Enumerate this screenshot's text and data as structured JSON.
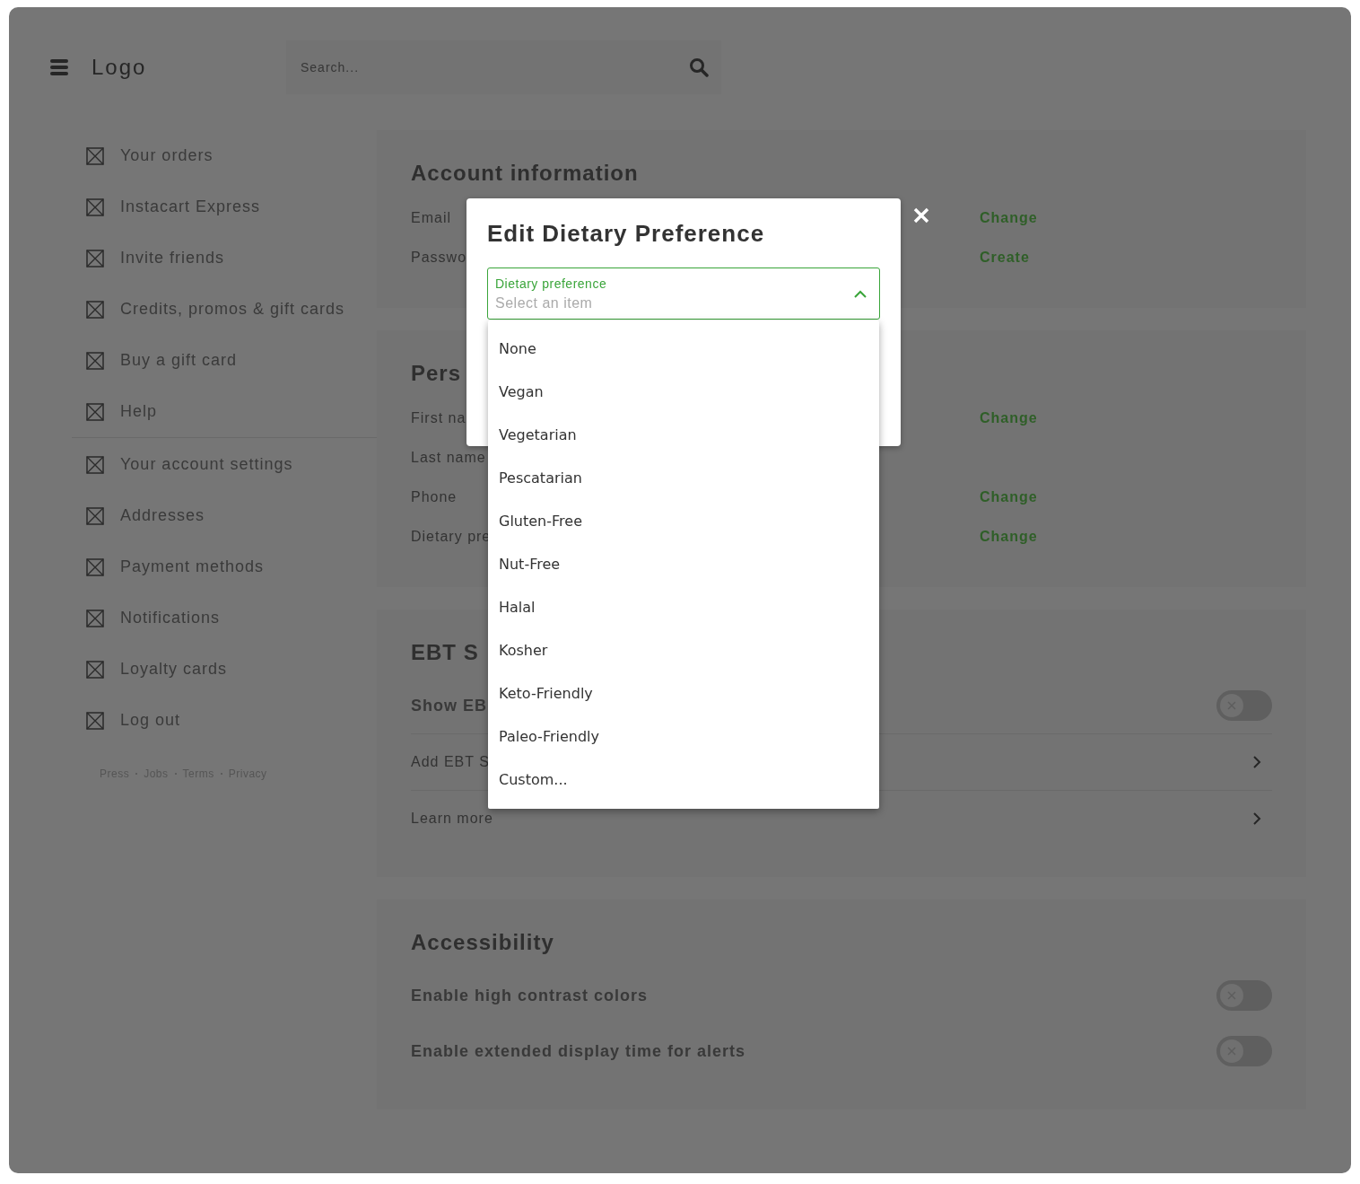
{
  "header": {
    "logo": "Logo",
    "search": {
      "placeholder": "Search..."
    }
  },
  "sidebar": {
    "groups": [
      {
        "items": [
          {
            "label": "Your orders"
          },
          {
            "label": "Instacart Express"
          },
          {
            "label": "Invite friends"
          },
          {
            "label": "Credits, promos & gift cards"
          },
          {
            "label": "Buy a gift card"
          },
          {
            "label": "Help"
          }
        ]
      },
      {
        "items": [
          {
            "label": "Your account settings"
          },
          {
            "label": "Addresses"
          },
          {
            "label": "Payment methods"
          },
          {
            "label": "Notifications"
          },
          {
            "label": "Loyalty cards"
          },
          {
            "label": "Log out"
          }
        ]
      }
    ],
    "footer_links": [
      "Press",
      "Jobs",
      "Terms",
      "Privacy"
    ]
  },
  "sections": [
    {
      "title": "Account information",
      "rows": [
        {
          "kind": "field",
          "label": "Email",
          "action": "Change"
        },
        {
          "kind": "field",
          "label": "Passwo",
          "action": "Create"
        }
      ]
    },
    {
      "title": "Pers",
      "rows": [
        {
          "kind": "field",
          "label": "First na",
          "action": "Change"
        },
        {
          "kind": "field",
          "label": "Last name"
        },
        {
          "kind": "field",
          "label": "Phone",
          "action": "Change"
        },
        {
          "kind": "field",
          "label": "Dietary pre",
          "action": "Change"
        }
      ]
    },
    {
      "title": "EBT S",
      "rows": [
        {
          "kind": "toggle",
          "label": "Show EB",
          "on": false
        },
        {
          "kind": "link",
          "label": "Add EBT S"
        },
        {
          "kind": "link",
          "label": "Learn more"
        }
      ]
    },
    {
      "title": "Accessibility",
      "rows": [
        {
          "kind": "toggle",
          "label": "Enable high contrast colors",
          "on": false
        },
        {
          "kind": "toggle",
          "label": "Enable extended display time for alerts",
          "on": false
        }
      ]
    }
  ],
  "modal": {
    "title": "Edit Dietary Preference",
    "select": {
      "label": "Dietary preference",
      "placeholder": "Select an item",
      "expanded": true,
      "options": [
        {
          "label": "None",
          "selected": false
        },
        {
          "label": "Vegan",
          "selected": false
        },
        {
          "label": "Vegetarian",
          "selected": false
        },
        {
          "label": "Pescatarian",
          "selected": false
        },
        {
          "label": "Gluten-Free",
          "selected": false
        },
        {
          "label": "Nut-Free",
          "selected": false
        },
        {
          "label": "Halal",
          "selected": false
        },
        {
          "label": "Kosher",
          "selected": false
        },
        {
          "label": "Keto-Friendly",
          "selected": false
        },
        {
          "label": "Paleo-Friendly",
          "selected": false
        },
        {
          "label": "Custom...",
          "selected": false
        }
      ]
    }
  }
}
